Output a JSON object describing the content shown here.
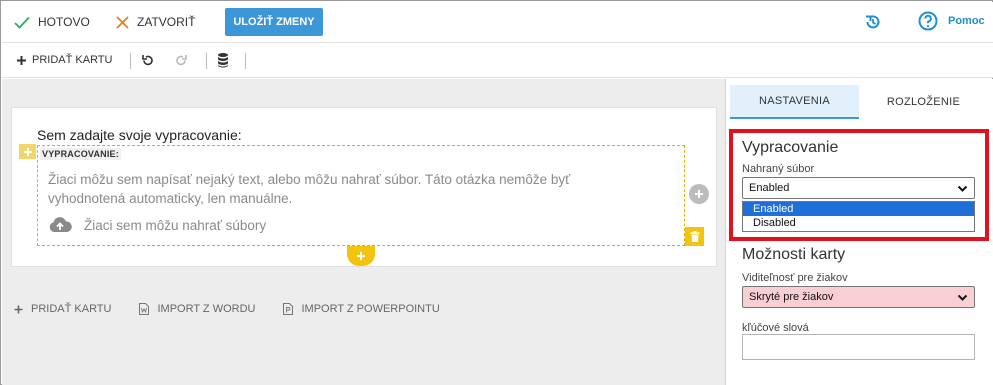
{
  "toolbar": {
    "done_label": "HOTOVO",
    "close_label": "ZATVORIŤ",
    "save_label": "ULOŽIŤ ZMENY",
    "help_label": "Pomoc",
    "colors": {
      "accent": "#3b97d8",
      "done": "#27ae60",
      "close": "#e67e22"
    }
  },
  "subtoolbar": {
    "add_card_label": "PRIDAŤ KARTU",
    "icons": [
      "undo-icon",
      "redo-icon",
      "database-icon"
    ]
  },
  "card": {
    "prompt": "Sem zadajte svoje vypracovanie:",
    "tag": "VYPRACOVANIE:",
    "description": "Žiaci môžu sem napísať nejaký text, alebo môžu nahrať súbor. Táto otázka nemôže byť vyhodnotená automaticky, len manuálne.",
    "upload_text": "Žiaci sem môžu nahrať súbory",
    "highlight_color": "#f1c40f"
  },
  "bottom_actions": {
    "add_card": "PRIDAŤ KARTU",
    "import_word": "IMPORT Z WORDU",
    "import_ppt": "IMPORT Z POWERPOINTU"
  },
  "panel": {
    "tabs": [
      {
        "label": "NASTAVENIA",
        "active": true
      },
      {
        "label": "ROZLOŽENIE",
        "active": false
      }
    ],
    "section1": {
      "title": "Vypracovanie",
      "field_label": "Nahraný súbor",
      "selected": "Enabled",
      "options": [
        "Enabled",
        "Disabled"
      ]
    },
    "section2": {
      "title": "Možnosti karty",
      "visibility_label": "Viditeľnosť pre žiakov",
      "visibility_value": "Skryté pre žiakov",
      "keywords_label": "kľúčové slová",
      "keywords_value": ""
    },
    "highlight_color": "#e3101e"
  }
}
